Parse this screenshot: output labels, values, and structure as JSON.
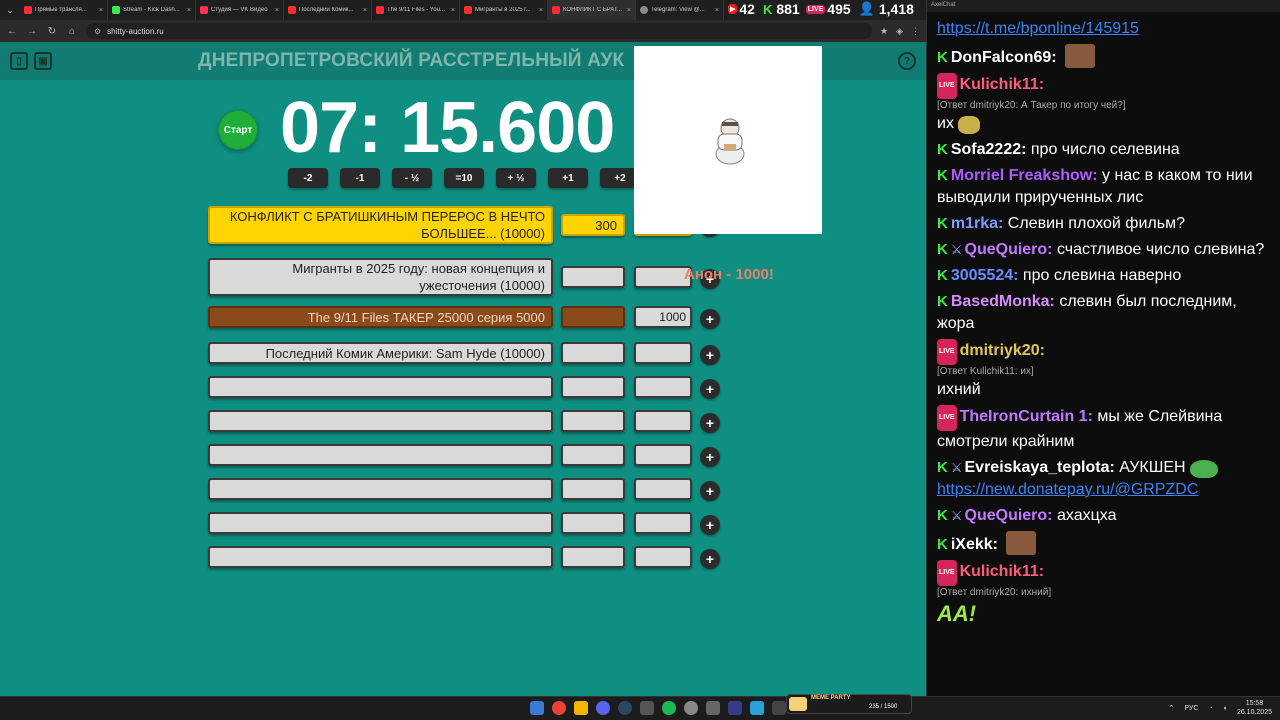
{
  "browser": {
    "tabs": [
      {
        "label": "Прямые трансля...",
        "icon": "yt"
      },
      {
        "label": "Stream - Kick Dash...",
        "icon": "kick"
      },
      {
        "label": "Студия — VK Видео",
        "icon": "vk"
      },
      {
        "label": "Последний Комик...",
        "icon": "yt"
      },
      {
        "label": "The 9/11 Files - You...",
        "icon": "yt"
      },
      {
        "label": "Мигранты в 2025 г...",
        "icon": "yt"
      },
      {
        "label": "КОНФЛИКТ С БРАТ...",
        "icon": "yt"
      },
      {
        "label": "Telegram: View @...",
        "icon": "tg"
      }
    ],
    "url": "shitty-auction.ru"
  },
  "stream_stats": {
    "youtube": "42",
    "kick": "881",
    "vk": "495",
    "viewers": "1,418"
  },
  "auction": {
    "title": "ДНЕПРОПЕТРОВСКИЙ РАССТРЕЛЬНЫЙ АУК",
    "start_label": "Старт",
    "timer": "07: 15.600",
    "time_buttons": [
      "-2",
      "-1",
      "- ½",
      "=10",
      "+ ½",
      "+1",
      "+2"
    ],
    "lots": [
      {
        "name": "КОНФЛИКТ С БРАТИШКИНЫМ ПЕРЕРОС В НЕЧТО БОЛЬШЕЕ... (10000)",
        "amount": "300",
        "add": "",
        "style": "gold"
      },
      {
        "name": "Мигранты в 2025 году: новая концепция и ужесточения (10000)",
        "amount": "",
        "add": "",
        "style": "plain"
      },
      {
        "name": "The 9/11 Files ТАКЕР 25000 серия 5000",
        "amount": "",
        "add": "1000",
        "style": "brown"
      },
      {
        "name": "Последний Комик Америки: Sam Hyde (10000)",
        "amount": "",
        "add": "",
        "style": "plain"
      },
      {
        "name": "",
        "amount": "",
        "add": "",
        "style": "plain"
      },
      {
        "name": "",
        "amount": "",
        "add": "",
        "style": "plain"
      },
      {
        "name": "",
        "amount": "",
        "add": "",
        "style": "plain"
      },
      {
        "name": "",
        "amount": "",
        "add": "",
        "style": "plain"
      },
      {
        "name": "",
        "amount": "",
        "add": "",
        "style": "plain"
      },
      {
        "name": "",
        "amount": "",
        "add": "",
        "style": "plain"
      }
    ],
    "plus_label": "+",
    "donation_notice": "Анон - 1000!"
  },
  "chat": {
    "window_title": "AxelChat",
    "messages": [
      {
        "platform": "",
        "user": "",
        "text": "",
        "link": "https://t.me/bponline/145915"
      },
      {
        "platform": "kick",
        "user": "DonFalcon69:",
        "user_color": "#ffffff",
        "emote": "face"
      },
      {
        "platform": "live",
        "user": "Kulichik11:",
        "user_color": "#ff5b7f",
        "reply": "[Ответ dmitriyk20: А Такер по итогу чей?]",
        "text": "их",
        "emote": "banana"
      },
      {
        "platform": "kick",
        "user": "Sofa2222:",
        "user_color": "#ffffff",
        "text": "про число селевина"
      },
      {
        "platform": "kick",
        "user": "Morriel Freakshow:",
        "user_color": "#b05bff",
        "text": "у нас в каком то нии выводили прирученных лис"
      },
      {
        "platform": "kick",
        "user": "m1rka:",
        "user_color": "#7f9bff",
        "text": "Слевин плохой фильм?"
      },
      {
        "platform": "kick",
        "user": "QueQuiero:",
        "user_color": "#c079ff",
        "sword": true,
        "text": "счастливое число слевина?"
      },
      {
        "platform": "kick",
        "user": "3005524:",
        "user_color": "#6b8cff",
        "text": "про слевина наверно"
      },
      {
        "platform": "kick",
        "user": "BasedMonka:",
        "user_color": "#d48cff",
        "text": "слевин был последним, жора"
      },
      {
        "platform": "live",
        "user": "dmitriyk20:",
        "user_color": "#e3c55a",
        "reply": "[Ответ Kulichik11: их]",
        "text": "ихний"
      },
      {
        "platform": "live",
        "user": "TheIronCurtain 1:",
        "user_color": "#c079ff",
        "text": "мы же Слейвина смотрели крайним"
      },
      {
        "platform": "kick",
        "user": "Evreiskaya_teplota:",
        "user_color": "#ffffff",
        "sword": true,
        "text": "АУКШЕН",
        "emote": "pepe",
        "link": "https://new.donatepay.ru/@GRPZDC"
      },
      {
        "platform": "kick",
        "user": "QueQuiero:",
        "user_color": "#c079ff",
        "sword": true,
        "text": "ахахцха"
      },
      {
        "platform": "kick",
        "user": "iXekk:",
        "user_color": "#ffffff",
        "emote": "face"
      },
      {
        "platform": "live",
        "user": "Kulichik11:",
        "user_color": "#ff5b7f",
        "reply": "[Ответ dmitriyk20: ихний]",
        "emote_text": "AA!"
      }
    ]
  },
  "taskbar": {
    "widget_title": "MEME PARTY",
    "widget_count": "235 / 1500",
    "lang": "РУС",
    "time": "15:58",
    "date": "26.10.2025"
  },
  "colors": {
    "page_bg": "#0f8f82",
    "gold_lot": "#ffd400",
    "brown_lot": "#8b4a1c",
    "start_green": "#1fae3a",
    "link_blue": "#3b82f6"
  }
}
